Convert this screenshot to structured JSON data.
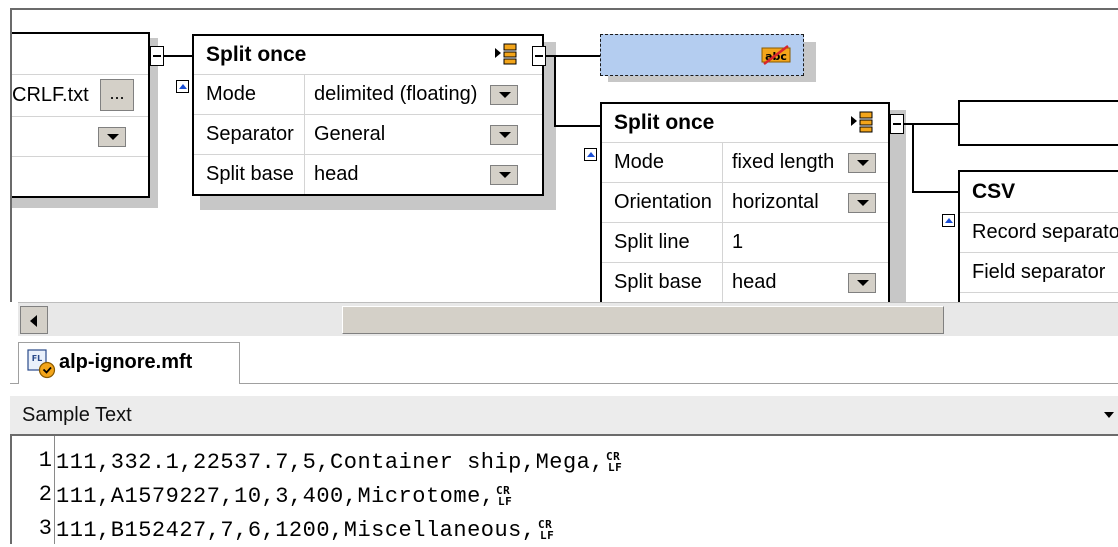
{
  "canvas": {
    "left_component": {
      "file_value": "CRLF.txt",
      "browse_label": "..."
    },
    "split1": {
      "title": "Split once",
      "rows": [
        {
          "label": "Mode",
          "value": "delimited (floating)"
        },
        {
          "label": "Separator",
          "value": "General"
        },
        {
          "label": "Split base",
          "value": "head"
        }
      ]
    },
    "abc_node": {
      "icon_text": "abc"
    },
    "split2": {
      "title": "Split once",
      "rows": [
        {
          "label": "Mode",
          "value": "fixed length"
        },
        {
          "label": "Orientation",
          "value": "horizontal"
        },
        {
          "label": "Split line",
          "value": "1"
        },
        {
          "label": "Split base",
          "value": "head"
        }
      ]
    },
    "csv": {
      "title": "CSV",
      "rows": [
        {
          "label": "Record separator",
          "value": ""
        },
        {
          "label": "Field separator",
          "value": ""
        }
      ]
    }
  },
  "tab": {
    "label": "alp-ignore.mft",
    "icon_badge": "FL"
  },
  "sample_panel": {
    "title": "Sample Text",
    "lines": [
      {
        "num": "1",
        "text": "111,332.1,22537.7,5,Container ship,Mega,"
      },
      {
        "num": "2",
        "text": "111,A1579227,10,3,400,Microtome,"
      },
      {
        "num": "3",
        "text": "111,B152427,7,6,1200,Miscellaneous,"
      }
    ]
  },
  "colors": {
    "selection_fill": "#b4cdf0",
    "accent_orange": "#f3a51a",
    "icon_red": "#d9262b",
    "arrow_blue": "#1a4fd6"
  }
}
